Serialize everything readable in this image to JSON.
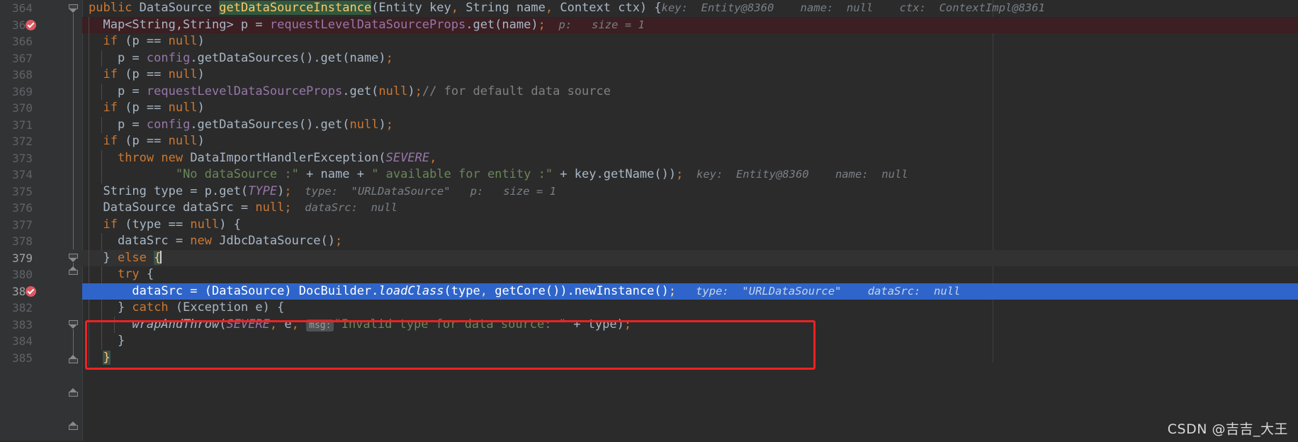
{
  "editor": {
    "language": "java",
    "theme": "darcula",
    "colors": {
      "background": "#2b2b2b",
      "gutter": "#313335",
      "line_number": "#606366",
      "current_execution_line": "#2f65ca",
      "breakpoint_line": "#3b1f22",
      "breakpoint_marker": "#db5860",
      "keyword": "#cc7832",
      "string": "#6a8759",
      "comment": "#808080",
      "field": "#9876aa",
      "method_declaration": "#ffc66d",
      "inline_debug_hint": "#7a7f85",
      "annotation_box": "#ee2222"
    },
    "right_margin_column_x": 1285
  },
  "gutter": {
    "line_numbers": [
      "364",
      "365",
      "366",
      "367",
      "368",
      "369",
      "370",
      "371",
      "372",
      "373",
      "374",
      "375",
      "376",
      "377",
      "378",
      "379",
      "380",
      "381",
      "382",
      "383",
      "384",
      "385"
    ],
    "breakpoint_lines": [
      "365",
      "381"
    ],
    "breakpoint_icon": "breakpoint-checked-icon",
    "fold_icon": "fold-marker-icon"
  },
  "code_lines": [
    {
      "number": "364",
      "text": "public DataSource getDataSourceInstance(Entity key, String name, Context ctx) {",
      "hints": [
        "key:  Entity@8360",
        "name:  null",
        "ctx:  ContextImpl@8361"
      ]
    },
    {
      "number": "365",
      "text": "  Map<String,String> p = requestLevelDataSourceProps.get(name);",
      "hints": [
        "p:   size = 1"
      ]
    },
    {
      "number": "366",
      "text": "  if (p == null)",
      "hints": []
    },
    {
      "number": "367",
      "text": "    p = config.getDataSources().get(name);",
      "hints": []
    },
    {
      "number": "368",
      "text": "  if (p == null)",
      "hints": []
    },
    {
      "number": "369",
      "text": "    p = requestLevelDataSourceProps.get(null);// for default data source",
      "hints": []
    },
    {
      "number": "370",
      "text": "  if (p == null)",
      "hints": []
    },
    {
      "number": "371",
      "text": "    p = config.getDataSources().get(null);",
      "hints": []
    },
    {
      "number": "372",
      "text": "  if (p == null)",
      "hints": []
    },
    {
      "number": "373",
      "text": "    throw new DataImportHandlerException(SEVERE,",
      "hints": []
    },
    {
      "number": "374",
      "text": "            \"No dataSource :\" + name + \" available for entity :\" + key.getName());",
      "hints": [
        "key:  Entity@8360",
        "name:  null"
      ]
    },
    {
      "number": "375",
      "text": "  String type = p.get(TYPE);",
      "hints": [
        "type:  \"URLDataSource\"",
        "p:   size = 1"
      ]
    },
    {
      "number": "376",
      "text": "  DataSource dataSrc = null;",
      "hints": [
        "dataSrc:  null"
      ]
    },
    {
      "number": "377",
      "text": "  if (type == null) {",
      "hints": []
    },
    {
      "number": "378",
      "text": "    dataSrc = new JdbcDataSource();",
      "hints": []
    },
    {
      "number": "379",
      "text": "  } else {",
      "hints": [],
      "caret_after": "{"
    },
    {
      "number": "380",
      "text": "    try {",
      "hints": []
    },
    {
      "number": "381",
      "text": "      dataSrc = (DataSource) DocBuilder.loadClass(type, getCore()).newInstance();",
      "hints": [
        "type:  \"URLDataSource\"",
        "dataSrc:  null"
      ],
      "is_current_execution_line": true
    },
    {
      "number": "382",
      "text": "    } catch (Exception e) {",
      "hints": []
    },
    {
      "number": "383",
      "text": "      wrapAndThrow(SEVERE, e, msg: \"Invalid type for data source: \" + type);",
      "hints": [],
      "parameter_hint": "msg:"
    },
    {
      "number": "384",
      "text": "    }",
      "hints": []
    },
    {
      "number": "385",
      "text": "  }",
      "hints": []
    }
  ],
  "annotation": {
    "type": "red-rectangle-highlight",
    "targets_line": "381",
    "color": "#ee2222"
  },
  "watermark": {
    "text": "CSDN @吉吉_大王"
  }
}
